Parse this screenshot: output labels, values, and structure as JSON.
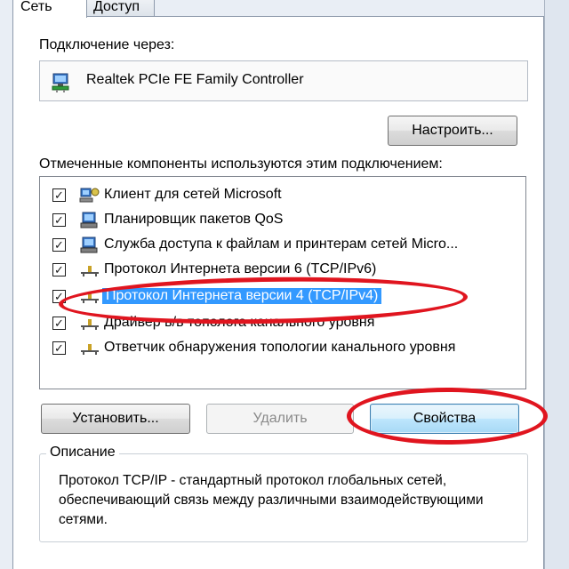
{
  "tabs": [
    {
      "label": "Сеть",
      "active": true
    },
    {
      "label": "Доступ",
      "active": false
    }
  ],
  "connection": {
    "label": "Подключение через:",
    "adapter_name": "Realtek PCIe FE Family Controller"
  },
  "configure_button": "Настроить...",
  "components": {
    "label": "Отмеченные компоненты используются этим подключением:",
    "items": [
      {
        "text": "Клиент для сетей Microsoft",
        "checked": true,
        "icon": "network-client-icon"
      },
      {
        "text": "Планировщик пакетов QoS",
        "checked": true,
        "icon": "network-service-icon"
      },
      {
        "text": "Служба доступа к файлам и принтерам сетей Micro...",
        "checked": true,
        "icon": "network-service-icon"
      },
      {
        "text": "Протокол Интернета версии 6 (TCP/IPv6)",
        "checked": true,
        "icon": "protocol-icon"
      },
      {
        "text": "Протокол Интернета версии 4 (TCP/IPv4)",
        "checked": true,
        "icon": "protocol-icon",
        "selected": true
      },
      {
        "text": "Драйвер в/в тополога канального уровня",
        "checked": true,
        "icon": "protocol-icon"
      },
      {
        "text": "Ответчик обнаружения топологии канального уровня",
        "checked": true,
        "icon": "protocol-icon"
      }
    ]
  },
  "buttons": {
    "install": "Установить...",
    "remove": "Удалить",
    "properties": "Свойства"
  },
  "description": {
    "legend": "Описание",
    "text": "Протокол TCP/IP - стандартный протокол глобальных сетей, обеспечивающий связь между различными взаимодействующими сетями."
  },
  "colors": {
    "selection": "#3399ff",
    "annotation": "#e0151f"
  }
}
